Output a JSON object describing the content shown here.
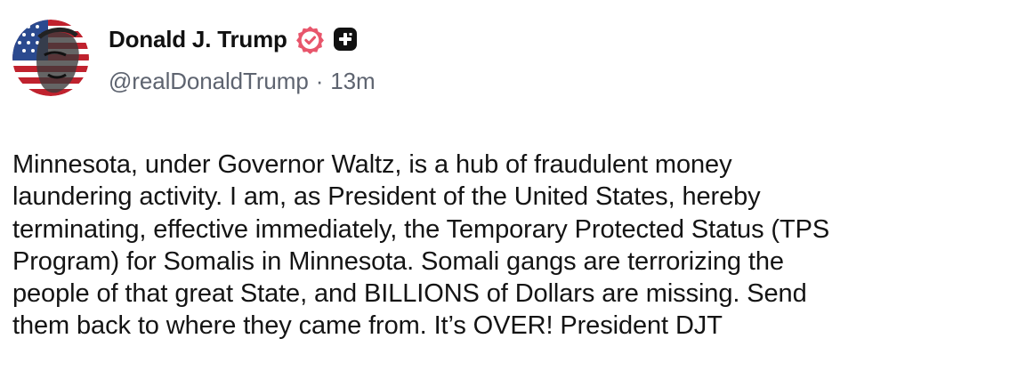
{
  "author": {
    "display_name": "Donald J. Trump",
    "handle": "@realDonaldTrump",
    "separator": "·",
    "timestamp": "13m",
    "avatar_icon": "flag-portrait-avatar",
    "verified_icon": "verified-badge-icon",
    "plus_icon": "plus-badge-icon",
    "verified_color": "#e8566c"
  },
  "post": {
    "text": "Minnesota, under Governor Waltz, is a hub of fraudulent money\nlaundering activity. I am, as President of the United States, hereby\nterminating, effective immediately, the Temporary Protected Status (TPS\nProgram) for Somalis in Minnesota. Somali gangs are terrorizing the\npeople of that great State, and BILLIONS of Dollars are missing. Send\nthem back to where they came from. It’s OVER! President DJT"
  }
}
